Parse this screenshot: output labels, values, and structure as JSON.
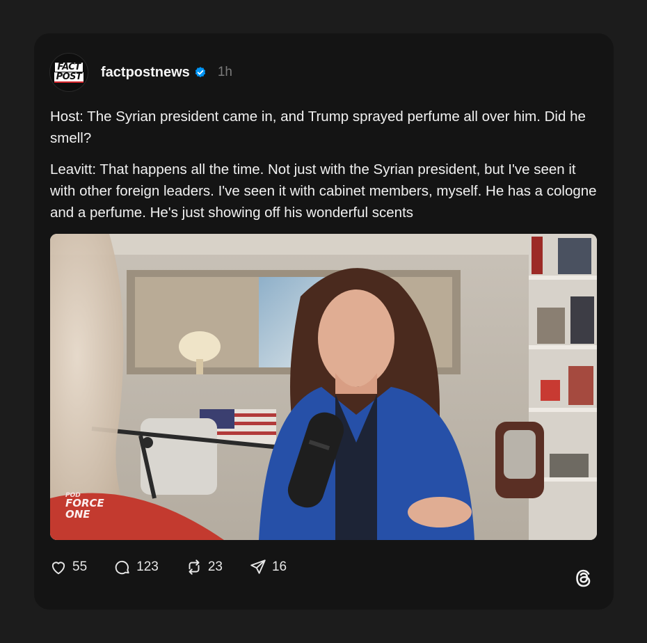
{
  "post": {
    "avatar": {
      "line1": "FACT",
      "line2": "POST"
    },
    "username": "factpostnews",
    "verified": true,
    "time": "1h",
    "paragraphs": [
      "Host: The Syrian president came in, and Trump sprayed perfume all over him. Did he smell?",
      "Leavitt: That happens all the time. Not just with the Syrian president, but I've seen it with other foreign leaders. I've seen it with cabinet members, myself. He has a cologne and a perfume. He's just showing off his wonderful scents"
    ],
    "media": {
      "watermark_line1": "POD",
      "watermark_line2": "FORCE",
      "watermark_line3": "ONE"
    },
    "actions": {
      "likes": "55",
      "replies": "123",
      "reposts": "23",
      "shares": "16"
    }
  },
  "colors": {
    "background": "#1c1c1c",
    "card": "#141414",
    "verified_blue": "#0095f6",
    "muted": "#7a7a7a"
  },
  "icons": [
    "heart-icon",
    "comment-icon",
    "repost-icon",
    "share-icon",
    "threads-logo-icon",
    "verified-badge-icon"
  ]
}
